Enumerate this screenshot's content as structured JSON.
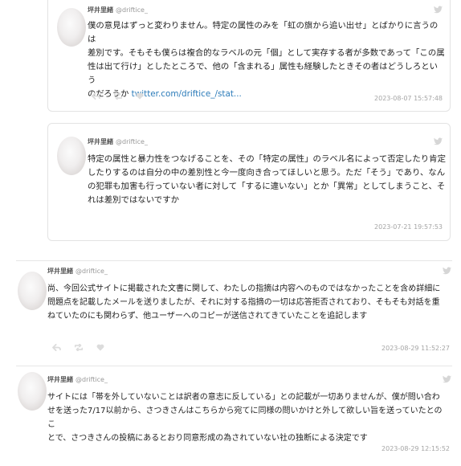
{
  "tweets": [
    {
      "name": "坪井里緒",
      "handle": "@driftice_",
      "lines": [
        "僕の意見はずっと変わりません。特定の属性のみを「虹の旗から追い出せ」とばかりに言うのは",
        "差別です。そもそも僕らは複合的なラベルの元「個」として実存する者が多数であって「この属",
        "性は出て行け」としたところで、他の「含まれる」属性も経験したときその者はどうしろという"
      ],
      "last_line": "のだろうか",
      "link": "twitter.com/driftice_/stat...",
      "timestamp": "2023-08-07 15:57:48"
    },
    {
      "name": "坪井里緒",
      "handle": "@driftice_",
      "lines": [
        "特定の属性と暴力性をつなげることを、その「特定の属性」のラベル名によって否定したり肯定",
        "したりするのは自分の中の差別性と今一度向き合ってほしいと思う。ただ「そう」であり、なん",
        "の犯罪も加害も行っていない者に対して「するに違いない」とか「異常」としてしまうこと、そ",
        "れは差別ではないですか"
      ],
      "timestamp": "2023-07-21 19:57:53"
    },
    {
      "name": "坪井里緒",
      "handle": "@driftice_",
      "lines": [
        "尚、今回公式サイトに掲載された文書に関して、わたしの指摘は内容へのものではなかったことを含め詳細に",
        "問題点を記載したメールを送りましたが、それに対する指摘の一切は応答拒否されており、そもそも対話を重",
        "ねていたのにも関わらず、他ユーザーへのコピーが送信されてきていたことを追記します"
      ],
      "timestamp": "2023-08-29 11:52:27"
    },
    {
      "name": "坪井里緒",
      "handle": "@driftice_",
      "lines": [
        "サイトには「帯を外していないことは訳者の意志に反している」との記載が一切ありませんが、僕が問い合わ",
        "せを送った7/17以前から、さつきさんはこちらから宛てに同様の問いかけと外して欲しい旨を送っていたとのこ",
        "とで、さつきさんの投稿にあるとおり同意形成の為されていない社の独断による決定です"
      ],
      "timestamp": "2023-08-29 12:15:52"
    }
  ]
}
